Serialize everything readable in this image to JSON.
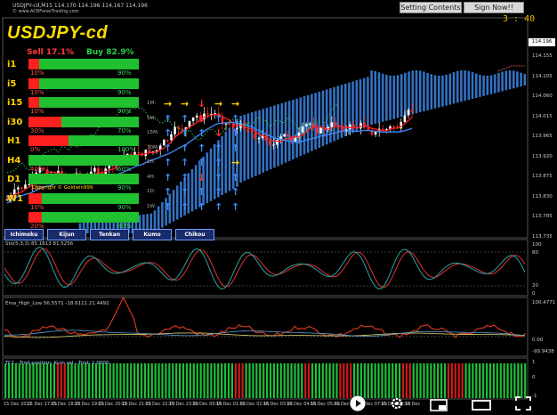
{
  "header": {
    "symbol_line": "USDJPY-cd,M15  114.170 114.196 114.167 114.196",
    "site": "© www.ACBForexTrading.com",
    "btn_settings": "Setting Contents",
    "btn_signup": "Sign Now!!",
    "timer": "3 : 40"
  },
  "dashboard": {
    "title": "USDJPY-cd",
    "sell": "Sell 17.1%",
    "buy": "Buy 82.9%",
    "rows": [
      {
        "tf": "i1",
        "left": "10%",
        "right": "90%",
        "red": 0.1
      },
      {
        "tf": "i5",
        "left": "10%",
        "right": "90%",
        "red": 0.1
      },
      {
        "tf": "i15",
        "left": "10%",
        "right": "90%",
        "red": 0.1
      },
      {
        "tf": "i30",
        "left": "30%",
        "right": "70%",
        "red": 0.3
      },
      {
        "tf": "H1",
        "left": "0%",
        "right": "100%",
        "red": 0.36
      },
      {
        "tf": "H4",
        "left": "40%",
        "right": "60%",
        "red": 0.0
      },
      {
        "tf": "D1",
        "left": "10%",
        "right": "90%",
        "red": 0.0
      },
      {
        "tf": "W1",
        "left": "10%",
        "right": "90%",
        "red": 0.12
      },
      {
        "tf": "",
        "left": "20%",
        "right": "80%",
        "red": 0.12
      }
    ],
    "footer_text": "Copyright © Goldwin999"
  },
  "tabs": [
    "Ichimoku",
    "Kijun",
    "Tenkan",
    "Kumo",
    "Chikou"
  ],
  "signal_grid": {
    "rows": [
      "1M:",
      "5M:",
      "15M:",
      "30M:",
      "1H:",
      "4H:",
      "1D:",
      "1W:"
    ]
  },
  "price_axis": {
    "current": "114.196",
    "ticks": [
      "114.196",
      "114.155",
      "114.105",
      "114.060",
      "114.015",
      "113.965",
      "113.920",
      "113.875",
      "113.830",
      "113.785",
      "113.735"
    ]
  },
  "stoch_pane": {
    "label": "Sto(5,3,3) 85.1613 81.5256",
    "ticks": [
      "100",
      "80",
      "20",
      "0"
    ]
  },
  "ema_pane": {
    "label": "Ema_High_Low 56.5571 -18.6111 21.4492",
    "ticks": [
      "100.4771",
      "0.00",
      "-99.9438"
    ]
  },
  "hist_pane": {
    "label": "TC1 - Trnd position: Kum sel - Trnd: 1.0000",
    "ticks": [
      "1",
      "0",
      "-1"
    ]
  },
  "time_axis": [
    "15 Dec 2021",
    "15 Dec 17:15",
    "15 Dec 18:15",
    "15 Dec 19:15",
    "15 Dec 20:15",
    "15 Dec 21:15",
    "15 Dec 22:15",
    "15 Dec 23:15",
    "16 Dec 00:15",
    "16 Dec 01:15",
    "16 Dec 02:15",
    "16 Dec 03:15",
    "16 Dec 04:15",
    "16 Dec 05:15",
    "16 Dec 06:15",
    "16 Dec 07:15",
    "16 Dec 08:15",
    "16 Dec"
  ],
  "colors": {
    "bull": "#ffffff",
    "bear": "#ff2a2a",
    "kumo": "#3a7fd9",
    "tenkan": "#ff2020",
    "kijun": "#3f8cff",
    "chikou": "#2ec24a",
    "hist_green": "#1fbf3a",
    "hist_red": "#d11a1a"
  }
}
